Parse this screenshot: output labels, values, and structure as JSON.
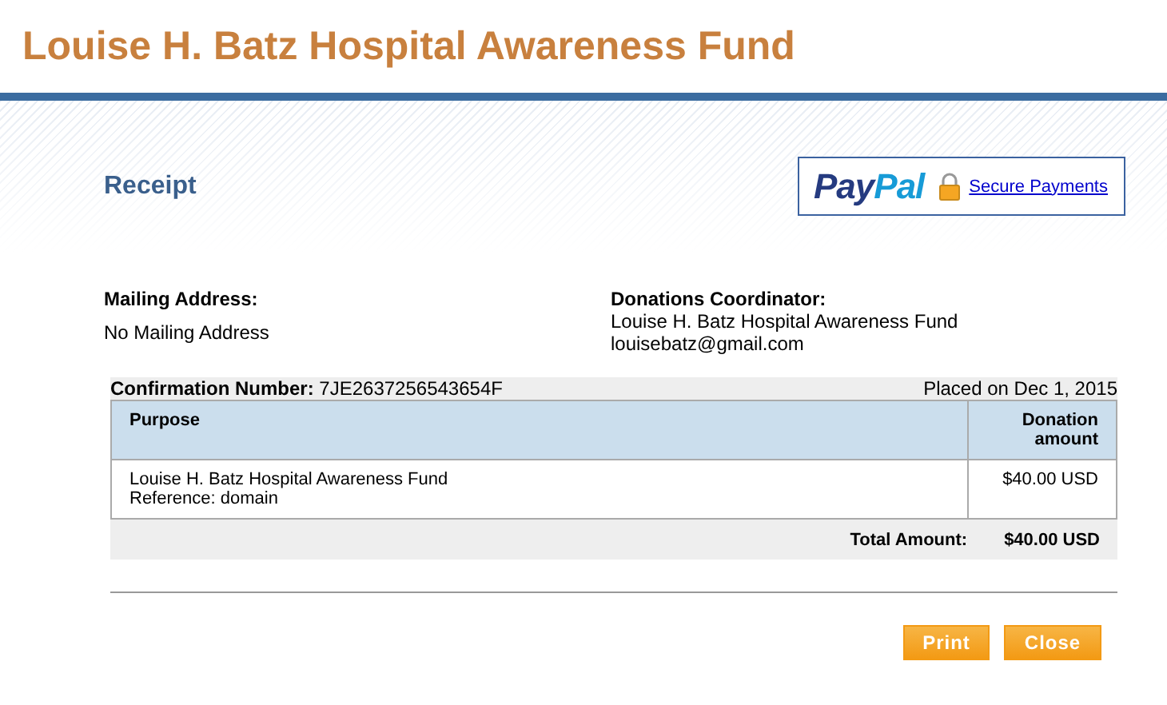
{
  "header": {
    "title": "Louise H. Batz Hospital Awareness Fund"
  },
  "receipt": {
    "heading": "Receipt",
    "logo": {
      "first": "Pay",
      "second": "Pal"
    },
    "secure_link": "Secure Payments"
  },
  "mailing": {
    "label": "Mailing Address:",
    "value": "No Mailing Address"
  },
  "coordinator": {
    "label": "Donations Coordinator:",
    "lines": [
      "Louise H. Batz Hospital Awareness Fund",
      "louisebatz@gmail.com"
    ]
  },
  "confirmation": {
    "label": "Confirmation Number:",
    "number": "7JE2637256543654F",
    "placed": "Placed on Dec 1, 2015"
  },
  "table": {
    "columns": [
      "Purpose",
      "Donation amount"
    ],
    "rows": [
      {
        "purpose": [
          "Louise H. Batz Hospital Awareness Fund",
          "Reference: domain"
        ],
        "amount": "$40.00 USD"
      }
    ],
    "total_label": "Total Amount:",
    "total": "$40.00 USD"
  },
  "buttons": [
    "Print",
    "Close"
  ]
}
